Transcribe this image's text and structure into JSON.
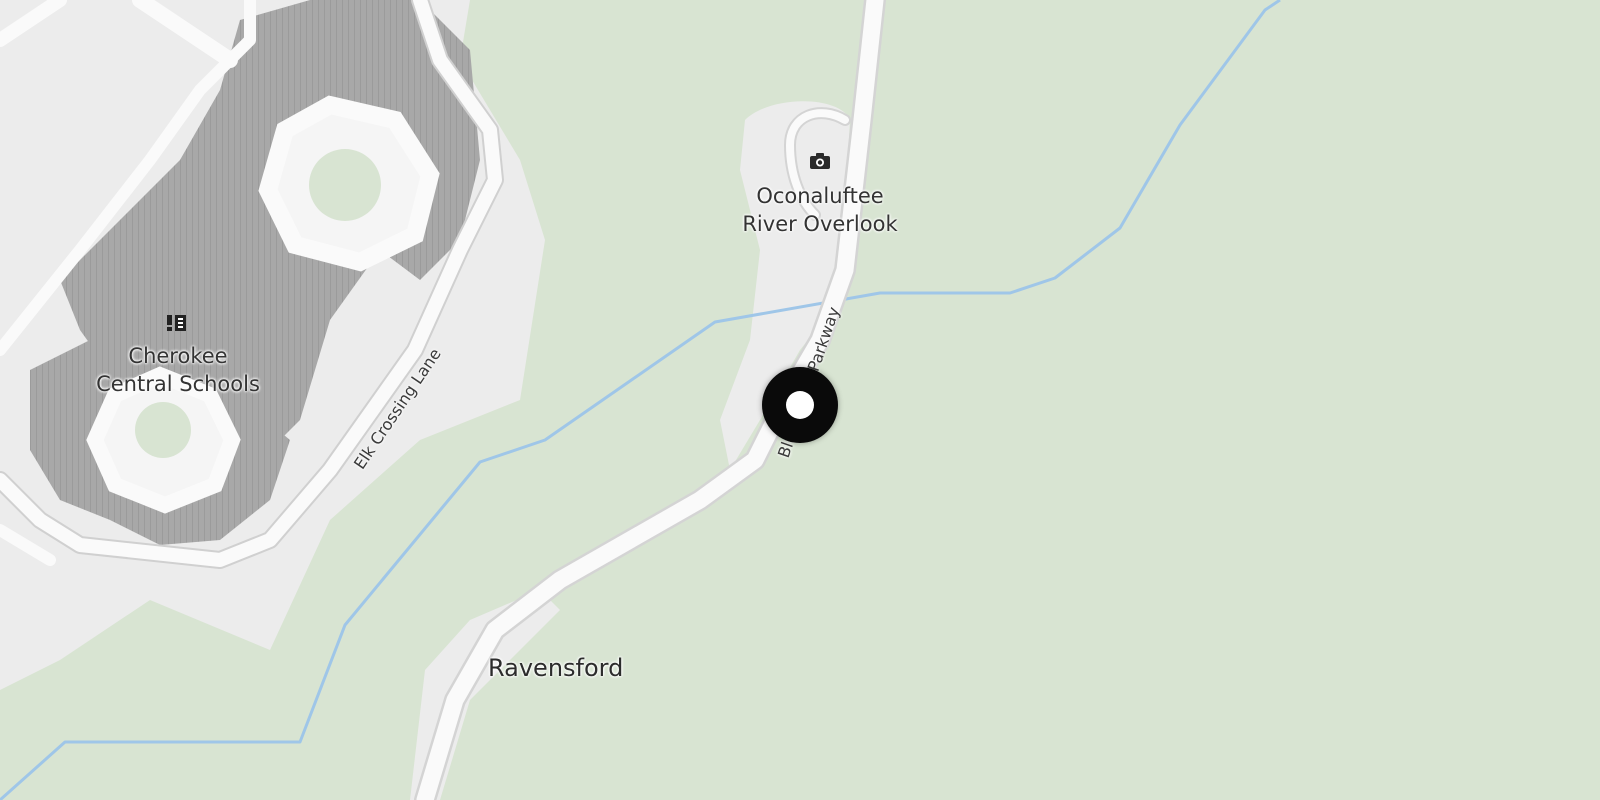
{
  "map": {
    "colors": {
      "forest": "#d8e4d2",
      "developed": "#ececec",
      "building": "#a9a9a9",
      "road": "#fafafa",
      "road_casing": "#d6d6d6",
      "water": "#9fc6e8",
      "marker": "#0a0a0a"
    },
    "pois": [
      {
        "id": "school",
        "icon": "school-icon",
        "label_line1": "Cherokee",
        "label_line2": "Central Schools"
      },
      {
        "id": "overlook",
        "icon": "camera-icon",
        "label_line1": "Oconaluftee",
        "label_line2": "River Overlook"
      }
    ],
    "places": [
      {
        "label": "Ravensford"
      }
    ],
    "roads": [
      {
        "label": "Elk Crossing Lane"
      },
      {
        "label": "Blue Ridge Parkway"
      }
    ],
    "marker": {
      "icon": "location-pin-icon"
    }
  }
}
